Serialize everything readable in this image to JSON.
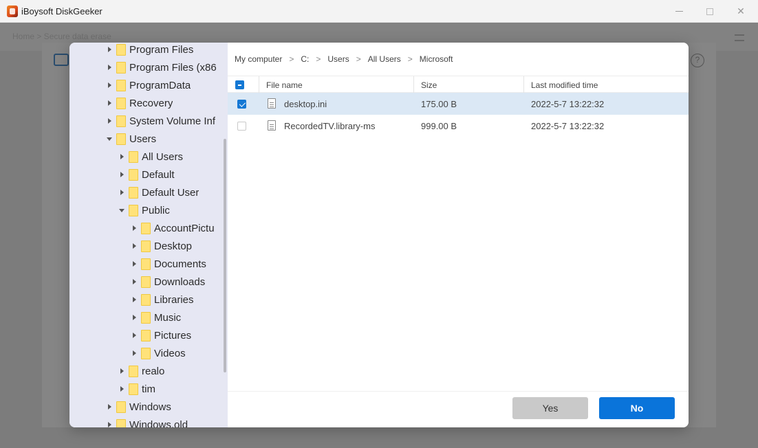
{
  "window": {
    "title": "iBoysoft DiskGeeker"
  },
  "background": {
    "breadcrumb": "Home  >  Secure data erase",
    "help_label": "?"
  },
  "tree": [
    {
      "label": "Program Files",
      "depth": 0,
      "expanded": false
    },
    {
      "label": "Program Files (x86",
      "depth": 0,
      "expanded": false
    },
    {
      "label": "ProgramData",
      "depth": 0,
      "expanded": false
    },
    {
      "label": "Recovery",
      "depth": 0,
      "expanded": false
    },
    {
      "label": "System Volume Inf",
      "depth": 0,
      "expanded": false
    },
    {
      "label": "Users",
      "depth": 0,
      "expanded": true
    },
    {
      "label": "All Users",
      "depth": 1,
      "expanded": false
    },
    {
      "label": "Default",
      "depth": 1,
      "expanded": false
    },
    {
      "label": "Default User",
      "depth": 1,
      "expanded": false
    },
    {
      "label": "Public",
      "depth": 1,
      "expanded": true
    },
    {
      "label": "AccountPictu",
      "depth": 2,
      "expanded": false
    },
    {
      "label": "Desktop",
      "depth": 2,
      "expanded": false
    },
    {
      "label": "Documents",
      "depth": 2,
      "expanded": false
    },
    {
      "label": "Downloads",
      "depth": 2,
      "expanded": false
    },
    {
      "label": "Libraries",
      "depth": 2,
      "expanded": false
    },
    {
      "label": "Music",
      "depth": 2,
      "expanded": false
    },
    {
      "label": "Pictures",
      "depth": 2,
      "expanded": false
    },
    {
      "label": "Videos",
      "depth": 2,
      "expanded": false
    },
    {
      "label": "realo",
      "depth": 1,
      "expanded": false
    },
    {
      "label": "tim",
      "depth": 1,
      "expanded": false
    },
    {
      "label": "Windows",
      "depth": 0,
      "expanded": false
    },
    {
      "label": "Windows.old",
      "depth": 0,
      "expanded": false
    }
  ],
  "breadcrumb": [
    "My computer",
    "C:",
    "Users",
    "All Users",
    "Microsoft"
  ],
  "columns": {
    "name": "File name",
    "size": "Size",
    "modified": "Last modified time"
  },
  "files": [
    {
      "name": "desktop.ini",
      "size": "175.00 B",
      "modified": "2022-5-7 13:22:32",
      "checked": true
    },
    {
      "name": "RecordedTV.library-ms",
      "size": "999.00 B",
      "modified": "2022-5-7 13:22:32",
      "checked": false
    }
  ],
  "buttons": {
    "yes": "Yes",
    "no": "No"
  },
  "colors": {
    "accent": "#0a74da",
    "selected_row": "#dbe8f5",
    "sidebar": "#e6e7f3"
  }
}
